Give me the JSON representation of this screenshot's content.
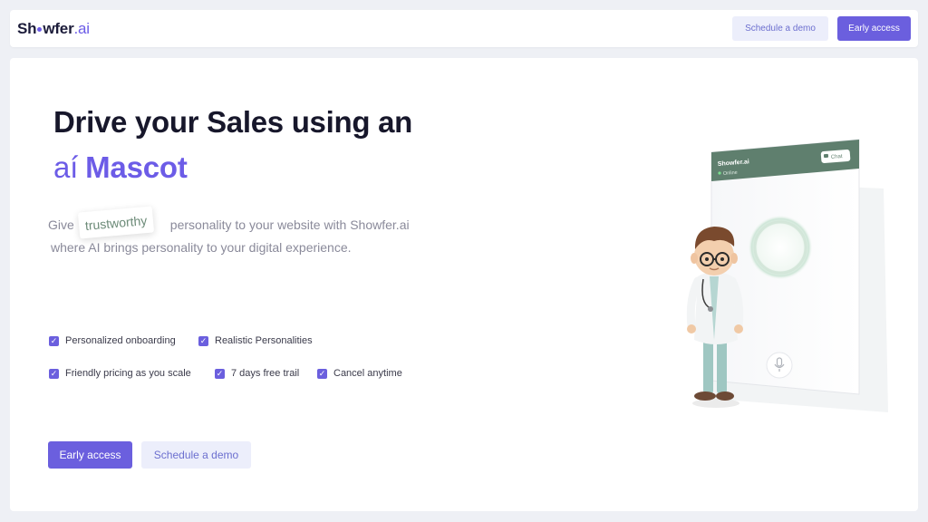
{
  "navbar": {
    "logo": {
      "prefix": "Sh",
      "middle": "wfer",
      "suffix": ".ai"
    },
    "schedule_demo_label": "Schedule a demo",
    "early_access_label": "Early access"
  },
  "hero": {
    "title_line1": "Drive your Sales using an",
    "title_line2_mark": "aí",
    "title_line2": "Mascot",
    "desc_prefix": "Give",
    "highlight_word": "trustworthy",
    "desc_suffix": "personality to your website with Showfer.ai",
    "desc_line2": "where AI brings personality to your digital experience.",
    "features": [
      "Personalized onboarding",
      "Realistic Personalities",
      "Friendly pricing as you scale",
      "7 days free trail",
      "Cancel anytime"
    ],
    "early_access_label": "Early access",
    "schedule_demo_label": "Schedule a demo"
  },
  "widget": {
    "brand": "Showfer.ai",
    "status": "Online",
    "chat_label": "Chat"
  },
  "colors": {
    "accent": "#6b5fde",
    "widget_header": "#5f7f6e",
    "orb": "#d6ecdf"
  },
  "icons": [
    "check-icon",
    "chat-icon",
    "mic-icon",
    "online-dot-icon"
  ]
}
